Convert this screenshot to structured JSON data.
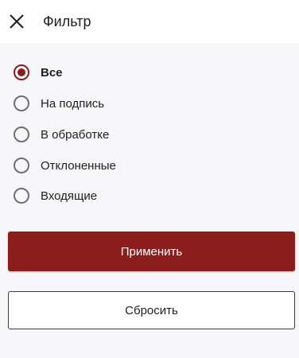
{
  "header": {
    "close_icon": "close-icon",
    "title": "Фильтр"
  },
  "filter": {
    "selected": "Все",
    "options": [
      {
        "label": "Все",
        "checked": true
      },
      {
        "label": "На подпись",
        "checked": false
      },
      {
        "label": "В обработке",
        "checked": false
      },
      {
        "label": "Отклоненные",
        "checked": false
      },
      {
        "label": "Входящие",
        "checked": false
      }
    ]
  },
  "actions": {
    "apply_label": "Применить",
    "reset_label": "Сбросить"
  },
  "colors": {
    "accent": "#8c1d1d",
    "background": "#f7f7f9"
  }
}
